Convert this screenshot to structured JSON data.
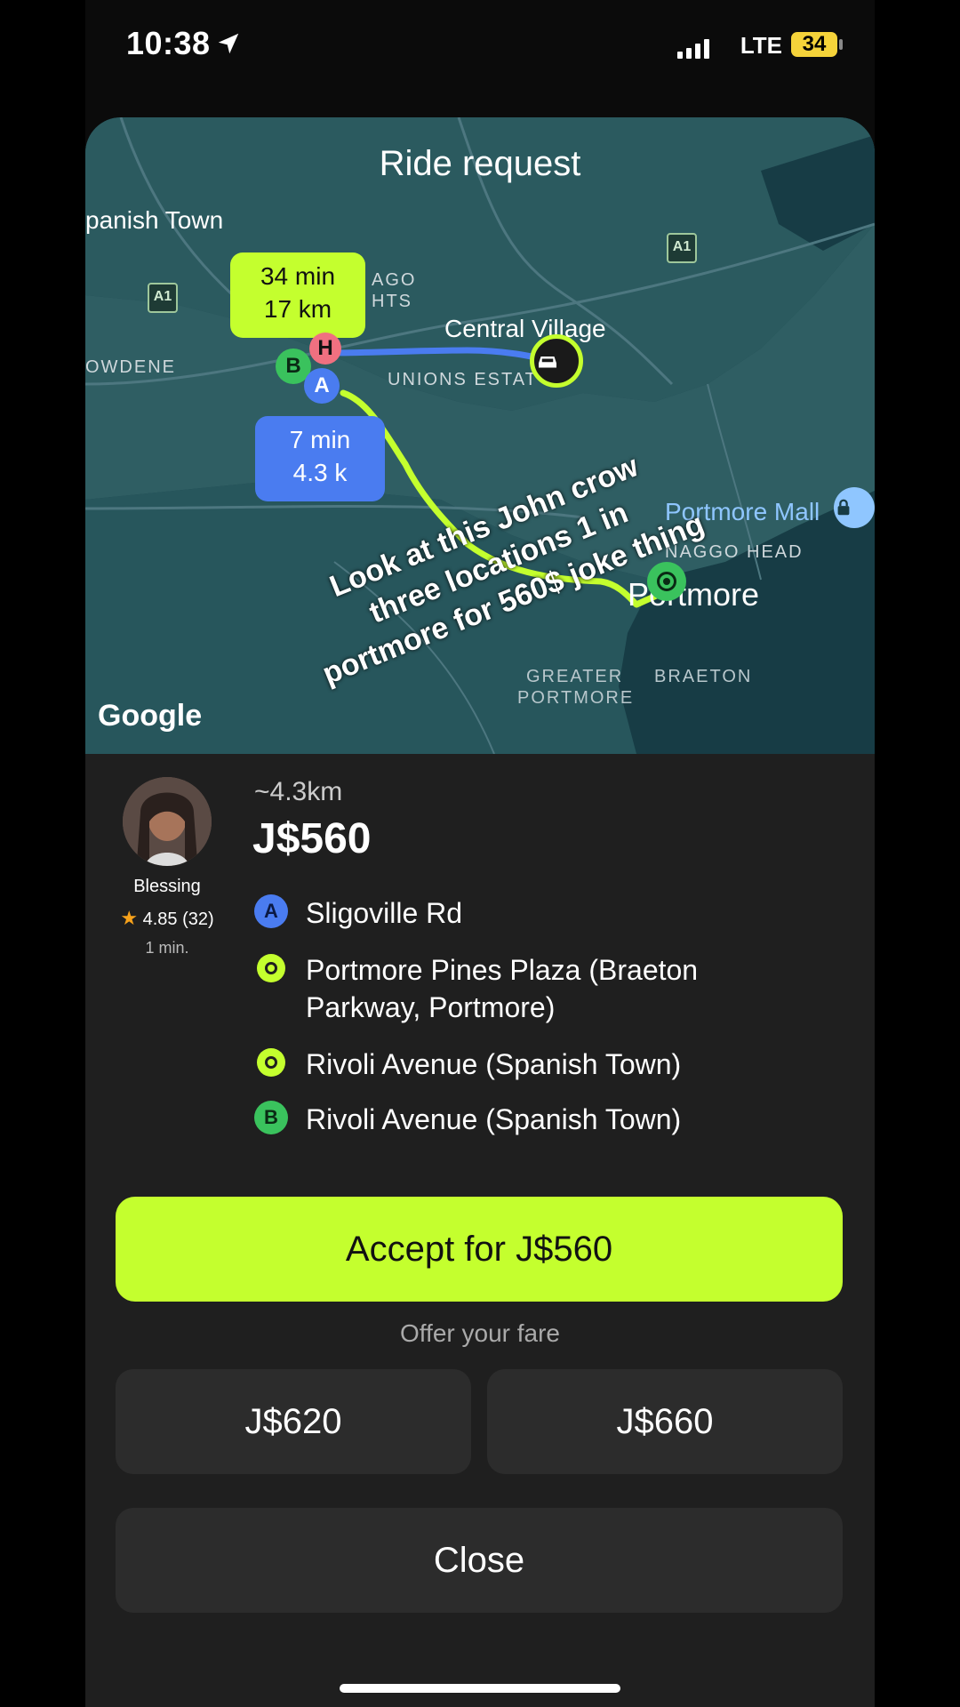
{
  "status_bar": {
    "time": "10:38",
    "network": "LTE",
    "battery": "34"
  },
  "map": {
    "title": "Ride request",
    "labels": {
      "spanish_town": "panish Town",
      "bowdene": "OWDENE",
      "central_village": "Central Village",
      "unions_estate": "UNIONS ESTAT",
      "ago_hts_1": "AGO",
      "ago_hts_2": "HTS",
      "portmore_mall": "Portmore Mall",
      "naggo_head": "NAGGO HEAD",
      "portmore": "Portmore",
      "greater_portmore_1": "GREATER",
      "greater_portmore_2": "PORTMORE",
      "braeton": "BRAETON"
    },
    "road_badges": [
      "A1",
      "A1"
    ],
    "trip_bubble": {
      "time": "34 min",
      "distance": "17 km"
    },
    "pickup_bubble": {
      "time": "7 min",
      "distance": "4.3 k"
    },
    "pins": {
      "a": "A",
      "b": "B",
      "h": "H"
    },
    "attribution": "Google",
    "overlay_caption": "Look at this John crow three locations 1 in portmore for 560$ joke thing",
    "colors": {
      "route_green": "#c4ff2e",
      "route_blue": "#4a7cf0",
      "water": "#1d4650"
    }
  },
  "driver": {
    "name": "Blessing",
    "rating": "4.85 (32)",
    "eta": "1 min."
  },
  "trip": {
    "distance": "~4.3km",
    "price": "J$560",
    "stops": [
      {
        "marker": "A",
        "type": "a",
        "text": "Sligoville Rd"
      },
      {
        "marker": "",
        "type": "dot",
        "text": "Portmore Pines Plaza (Braeton Parkway, Portmore)"
      },
      {
        "marker": "",
        "type": "dot",
        "text": "Rivoli Avenue (Spanish Town)"
      },
      {
        "marker": "B",
        "type": "b",
        "text": "Rivoli Avenue (Spanish Town)"
      }
    ]
  },
  "actions": {
    "accept_label": "Accept for J$560",
    "offer_label": "Offer your fare",
    "fare_options": [
      "J$620",
      "J$660"
    ],
    "close_label": "Close"
  },
  "icons": {
    "location": "location-arrow-icon",
    "star": "star-icon",
    "car": "car-icon",
    "lock": "lock-bag-icon"
  }
}
